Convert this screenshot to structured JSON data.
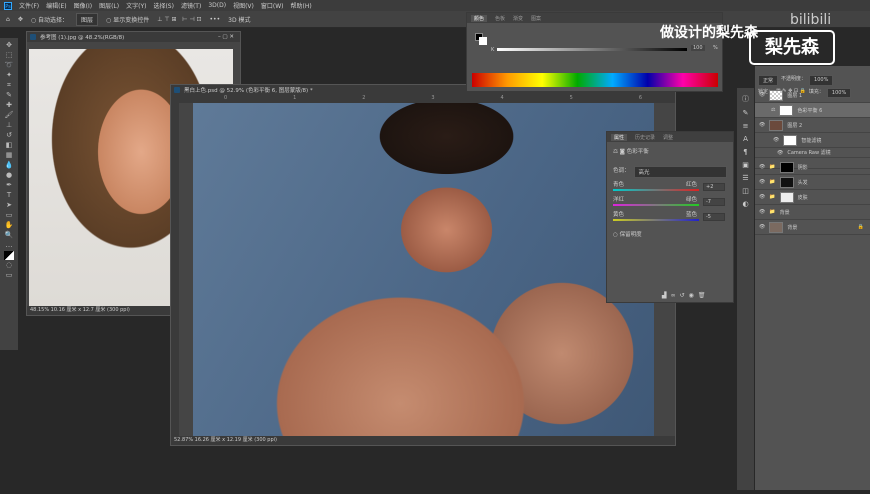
{
  "menu": [
    "文件(F)",
    "编辑(E)",
    "图像(I)",
    "图层(L)",
    "文字(Y)",
    "选择(S)",
    "滤镜(T)",
    "3D(D)",
    "视图(V)",
    "窗口(W)",
    "帮助(H)"
  ],
  "options": {
    "auto_select": "自动选择：",
    "target": "图层",
    "show_transform": "显示变换控件",
    "mode3d": "3D 模式"
  },
  "doc1": {
    "title": "参考图 (1).jpg @ 48.2%(RGB/8)",
    "status": "48.15%   10.16 厘米 x 12.7 厘米 (300 ppi)"
  },
  "doc2": {
    "title": "黑白上色.psd @ 52.9% (色彩平衡 6, 图层蒙版/8) *",
    "status": "52.87%   16.26 厘米 x 12.19 厘米 (300 ppi)",
    "ruler": [
      "0",
      "1",
      "2",
      "3",
      "4",
      "5",
      "6"
    ]
  },
  "color_panel": {
    "tabs": [
      "颜色",
      "色板",
      "渐变",
      "图案"
    ],
    "channel": "K",
    "value": "100",
    "unit": "%"
  },
  "properties": {
    "tabs": [
      "属性",
      "历史记录",
      "调整"
    ],
    "title": "色彩平衡",
    "tone_label": "色调：",
    "tone": "高光",
    "sliders": [
      {
        "left": "青色",
        "right": "红色",
        "value": "+2"
      },
      {
        "left": "洋红",
        "right": "绿色",
        "value": "-7"
      },
      {
        "left": "黄色",
        "right": "蓝色",
        "value": "-5"
      }
    ],
    "preserve": "保留明度"
  },
  "layers_panel": {
    "mode": "正常",
    "opacity_label": "不透明度：",
    "opacity": "100%",
    "lock_label": "锁定：",
    "fill_label": "填充：",
    "fill": "100%",
    "layers": [
      "图层 1",
      "色彩平衡 6",
      "图层 2",
      "智能滤镜",
      "Camera Raw 滤镜",
      "阴影",
      "头发",
      "皮肤",
      "背景",
      "背景"
    ]
  },
  "watermark": {
    "text": "做设计的梨先森",
    "logo": "梨先森",
    "site": "bilibili"
  }
}
